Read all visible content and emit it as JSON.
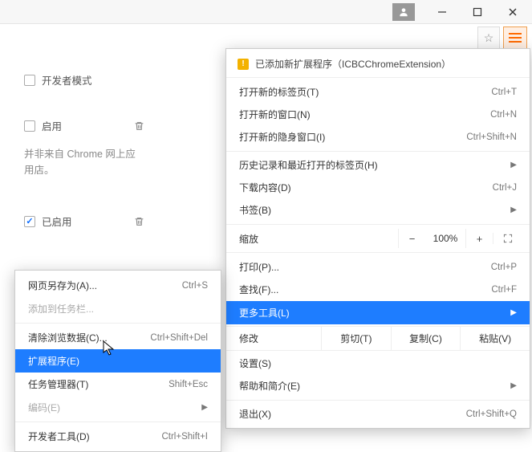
{
  "titlebar": {},
  "toolbar": {},
  "left": {
    "dev_mode": "开发者模式",
    "enable": "启用",
    "note": "并非来自 Chrome 网上应用店。",
    "enabled": "已启用"
  },
  "notice": {
    "text": "已添加新扩展程序（ICBCChromeExtension）"
  },
  "menu": {
    "new_tab": "打开新的标签页(T)",
    "new_tab_sc": "Ctrl+T",
    "new_window": "打开新的窗口(N)",
    "new_window_sc": "Ctrl+N",
    "incognito": "打开新的隐身窗口(I)",
    "incognito_sc": "Ctrl+Shift+N",
    "history": "历史记录和最近打开的标签页(H)",
    "downloads": "下载内容(D)",
    "downloads_sc": "Ctrl+J",
    "bookmarks": "书签(B)",
    "zoom_label": "缩放",
    "zoom_value": "100%",
    "zoom_minus": "−",
    "zoom_plus": "+",
    "print": "打印(P)...",
    "print_sc": "Ctrl+P",
    "find": "查找(F)...",
    "find_sc": "Ctrl+F",
    "more_tools": "更多工具(L)",
    "edit": "修改",
    "cut": "剪切(T)",
    "copy": "复制(C)",
    "paste": "粘贴(V)",
    "settings": "设置(S)",
    "help": "帮助和简介(E)",
    "exit": "退出(X)",
    "exit_sc": "Ctrl+Shift+Q"
  },
  "submenu": {
    "save_as": "网页另存为(A)...",
    "save_as_sc": "Ctrl+S",
    "add_taskbar": "添加到任务栏...",
    "clear_data": "清除浏览数据(C)...",
    "clear_data_sc": "Ctrl+Shift+Del",
    "extensions": "扩展程序(E)",
    "task_manager": "任务管理器(T)",
    "task_manager_sc": "Shift+Esc",
    "encoding": "编码(E)",
    "dev_tools": "开发者工具(D)",
    "dev_tools_sc": "Ctrl+Shift+I"
  }
}
